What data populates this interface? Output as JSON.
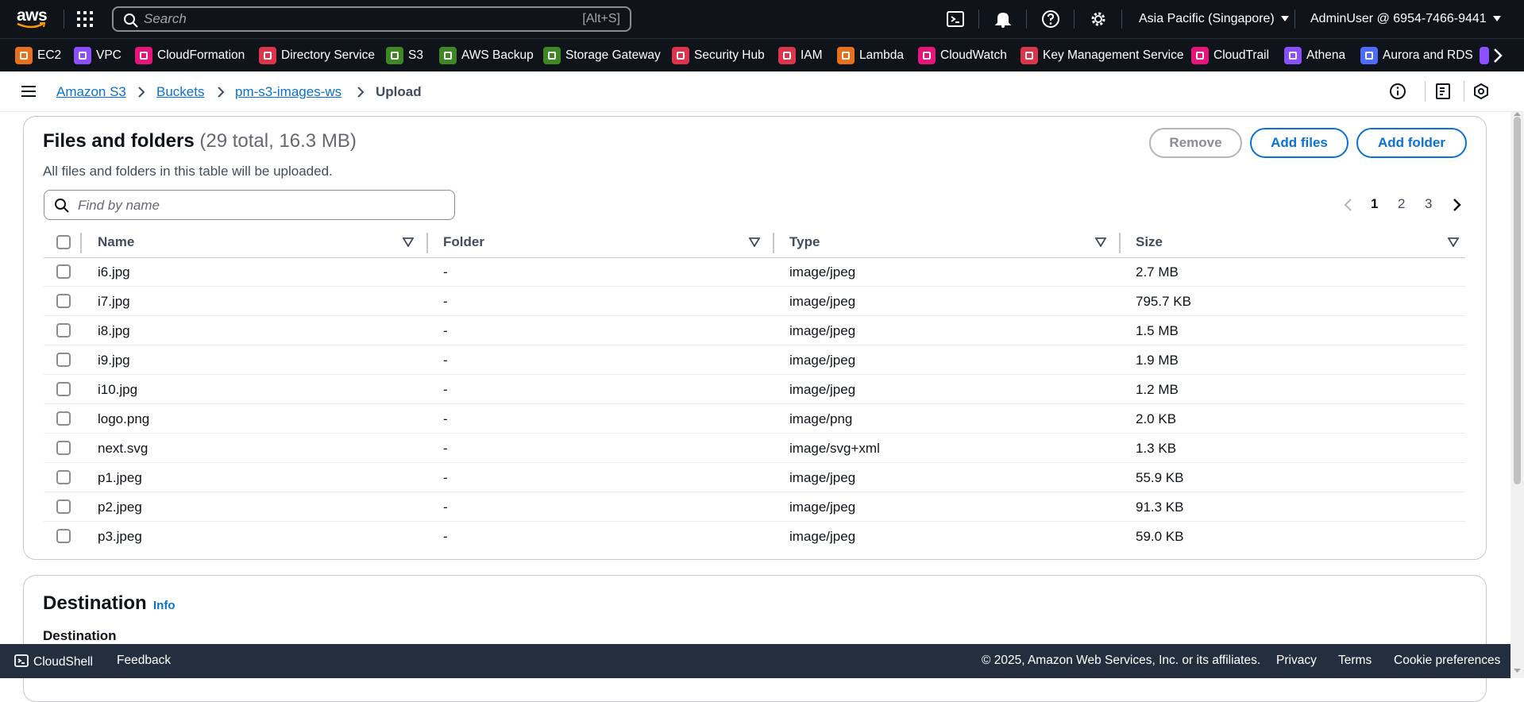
{
  "topnav": {
    "logo_text": "aws",
    "search_placeholder": "Search",
    "search_shortcut": "[Alt+S]",
    "region": "Asia Pacific (Singapore)",
    "account": "AdminUser @ 6954-7466-9441"
  },
  "favorites": [
    {
      "label": "EC2",
      "color": "#e7701c"
    },
    {
      "label": "VPC",
      "color": "#8c4fff"
    },
    {
      "label": "CloudFormation",
      "color": "#e7157b"
    },
    {
      "label": "Directory Service",
      "color": "#dd344c"
    },
    {
      "label": "S3",
      "color": "#3f8624"
    },
    {
      "label": "AWS Backup",
      "color": "#3f8624"
    },
    {
      "label": "Storage Gateway",
      "color": "#3f8624"
    },
    {
      "label": "Security Hub",
      "color": "#dd344c"
    },
    {
      "label": "IAM",
      "color": "#dd344c"
    },
    {
      "label": "Lambda",
      "color": "#e7701c"
    },
    {
      "label": "CloudWatch",
      "color": "#e7157b"
    },
    {
      "label": "Key Management Service",
      "color": "#dd344c"
    },
    {
      "label": "CloudTrail",
      "color": "#e7157b"
    },
    {
      "label": "Athena",
      "color": "#8c4fff"
    },
    {
      "label": "Aurora and RDS",
      "color": "#4d6bff"
    }
  ],
  "breadcrumb": [
    "Amazon S3",
    "Buckets",
    "pm-s3-images-ws",
    "Upload"
  ],
  "files": {
    "title": "Files and folders",
    "count": "(29 total, 16.3 MB)",
    "description": "All files and folders in this table will be uploaded.",
    "remove_label": "Remove",
    "add_files_label": "Add files",
    "add_folder_label": "Add folder",
    "filter_placeholder": "Find by name",
    "pages": [
      "1",
      "2",
      "3"
    ],
    "current_page": "1",
    "columns": [
      "Name",
      "Folder",
      "Type",
      "Size"
    ],
    "rows": [
      {
        "name": "i6.jpg",
        "folder": "-",
        "type": "image/jpeg",
        "size": "2.7 MB"
      },
      {
        "name": "i7.jpg",
        "folder": "-",
        "type": "image/jpeg",
        "size": "795.7 KB"
      },
      {
        "name": "i8.jpg",
        "folder": "-",
        "type": "image/jpeg",
        "size": "1.5 MB"
      },
      {
        "name": "i9.jpg",
        "folder": "-",
        "type": "image/jpeg",
        "size": "1.9 MB"
      },
      {
        "name": "i10.jpg",
        "folder": "-",
        "type": "image/jpeg",
        "size": "1.2 MB"
      },
      {
        "name": "logo.png",
        "folder": "-",
        "type": "image/png",
        "size": "2.0 KB"
      },
      {
        "name": "next.svg",
        "folder": "-",
        "type": "image/svg+xml",
        "size": "1.3 KB"
      },
      {
        "name": "p1.jpeg",
        "folder": "-",
        "type": "image/jpeg",
        "size": "55.9 KB"
      },
      {
        "name": "p2.jpeg",
        "folder": "-",
        "type": "image/jpeg",
        "size": "91.3 KB"
      },
      {
        "name": "p3.jpeg",
        "folder": "-",
        "type": "image/jpeg",
        "size": "59.0 KB"
      }
    ]
  },
  "destination": {
    "title": "Destination",
    "info_label": "Info",
    "subheading": "Destination"
  },
  "footer": {
    "cloudshell": "CloudShell",
    "feedback": "Feedback",
    "copyright": "© 2025, Amazon Web Services, Inc. or its affiliates.",
    "privacy": "Privacy",
    "terms": "Terms",
    "cookies": "Cookie preferences"
  }
}
